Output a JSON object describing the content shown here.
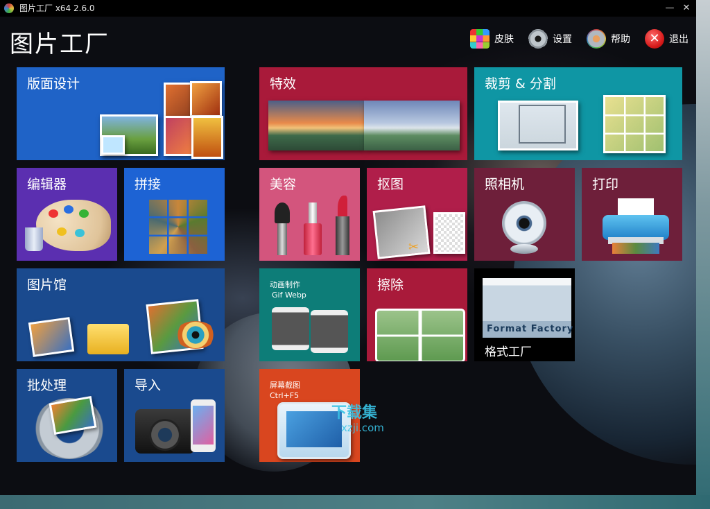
{
  "window": {
    "title": "图片工厂 x64 2.6.0",
    "minimize_glyph": "—",
    "close_glyph": "✕",
    "icon": "app-logo-icon"
  },
  "header": {
    "app_title": "图片工厂",
    "buttons": [
      {
        "label": "皮肤",
        "icon": "palette-grid-icon"
      },
      {
        "label": "设置",
        "icon": "gear-icon"
      },
      {
        "label": "帮助",
        "icon": "help-gear-icon"
      },
      {
        "label": "退出",
        "icon": "close-circle-icon",
        "glyph": "✕"
      }
    ]
  },
  "tiles": {
    "layout_design": {
      "label": "版面设计",
      "color": "#1f63c7"
    },
    "effects": {
      "label": "特效",
      "color": "#a91a3a"
    },
    "crop_split": {
      "label": "裁剪 & 分割",
      "color": "#0f96a4"
    },
    "editor": {
      "label": "编辑器",
      "color": "#5b2fb0"
    },
    "stitch": {
      "label": "拼接",
      "color": "#1d63d4"
    },
    "beauty": {
      "label": "美容",
      "color": "#d3557d"
    },
    "cutout": {
      "label": "抠图",
      "color": "#b01e4a"
    },
    "camera": {
      "label": "照相机",
      "color": "#6e1f3a"
    },
    "print": {
      "label": "打印",
      "color": "#6e1f3a"
    },
    "gallery": {
      "label": "图片馆",
      "color": "#1a4a8e"
    },
    "animation": {
      "label": "动画制作",
      "sub": "Gif Webp",
      "color": "#0d7d78"
    },
    "erase": {
      "label": "擦除",
      "color": "#a91a3a"
    },
    "format_factory": {
      "label": "格式工厂",
      "banner": "Format Factory",
      "color": "#000000"
    },
    "batch": {
      "label": "批处理",
      "color": "#1a4a8e"
    },
    "import": {
      "label": "导入",
      "color": "#1a4a8e"
    },
    "screenshot": {
      "label": "屏幕截图",
      "sub": "Ctrl+F5",
      "color": "#d9461f"
    }
  },
  "watermark": {
    "line1": "下载集",
    "line2": "xzji.com"
  }
}
